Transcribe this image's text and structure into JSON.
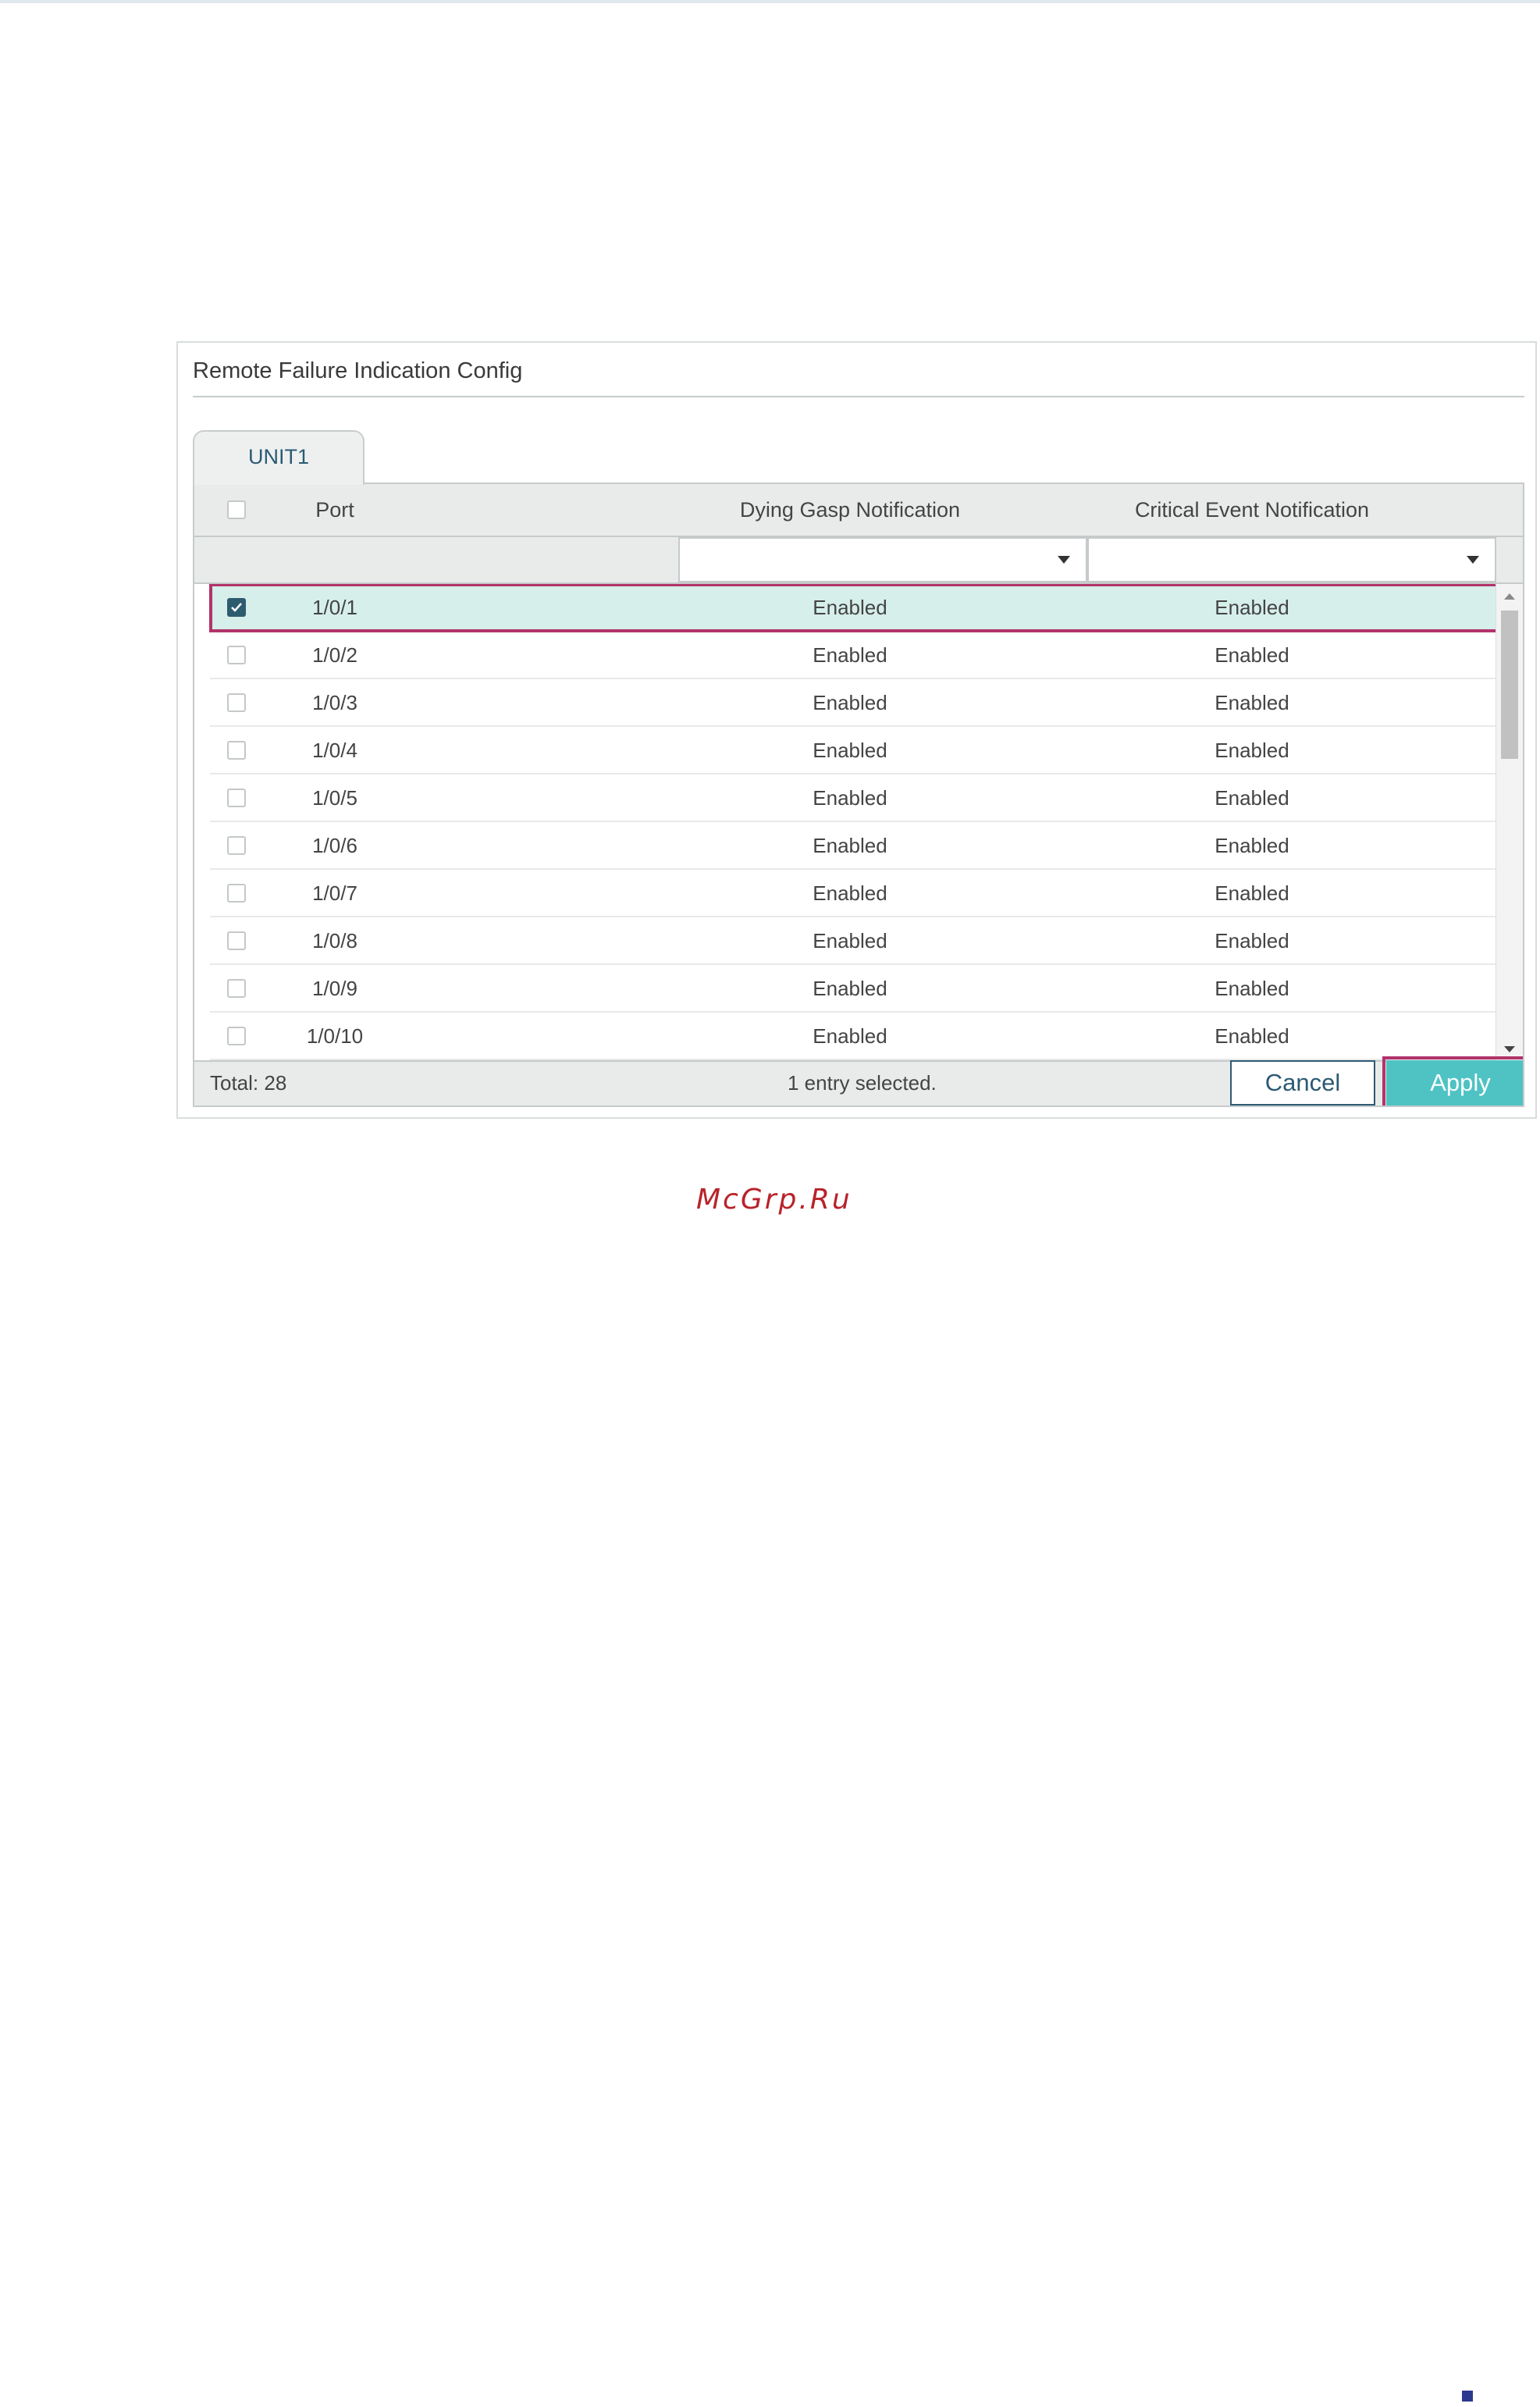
{
  "panel": {
    "title": "Remote Failure Indication Config",
    "tab": "UNIT1"
  },
  "table": {
    "columns": [
      "Port",
      "Dying Gasp Notification",
      "Critical Event Notification"
    ],
    "filters": [
      "",
      ""
    ],
    "rows": [
      {
        "port": "1/0/1",
        "dying_gasp": "Enabled",
        "critical_event": "Enabled",
        "checked": true
      },
      {
        "port": "1/0/2",
        "dying_gasp": "Enabled",
        "critical_event": "Enabled",
        "checked": false
      },
      {
        "port": "1/0/3",
        "dying_gasp": "Enabled",
        "critical_event": "Enabled",
        "checked": false
      },
      {
        "port": "1/0/4",
        "dying_gasp": "Enabled",
        "critical_event": "Enabled",
        "checked": false
      },
      {
        "port": "1/0/5",
        "dying_gasp": "Enabled",
        "critical_event": "Enabled",
        "checked": false
      },
      {
        "port": "1/0/6",
        "dying_gasp": "Enabled",
        "critical_event": "Enabled",
        "checked": false
      },
      {
        "port": "1/0/7",
        "dying_gasp": "Enabled",
        "critical_event": "Enabled",
        "checked": false
      },
      {
        "port": "1/0/8",
        "dying_gasp": "Enabled",
        "critical_event": "Enabled",
        "checked": false
      },
      {
        "port": "1/0/9",
        "dying_gasp": "Enabled",
        "critical_event": "Enabled",
        "checked": false
      },
      {
        "port": "1/0/10",
        "dying_gasp": "Enabled",
        "critical_event": "Enabled",
        "checked": false
      }
    ]
  },
  "footer": {
    "total": "Total: 28",
    "selection": "1 entry selected.",
    "cancel_label": "Cancel",
    "apply_label": "Apply"
  },
  "watermark": "McGrp.Ru",
  "colors": {
    "accent": "#4fc3c3",
    "highlight": "#b2336a",
    "selected_row": "#d6efea",
    "brand_dark": "#2c5a74"
  },
  "icons": {
    "checkbox_checked": "check-icon",
    "dropdown": "chevron-down-icon",
    "scroll_up": "arrow-up-icon",
    "scroll_down": "arrow-down-icon"
  }
}
